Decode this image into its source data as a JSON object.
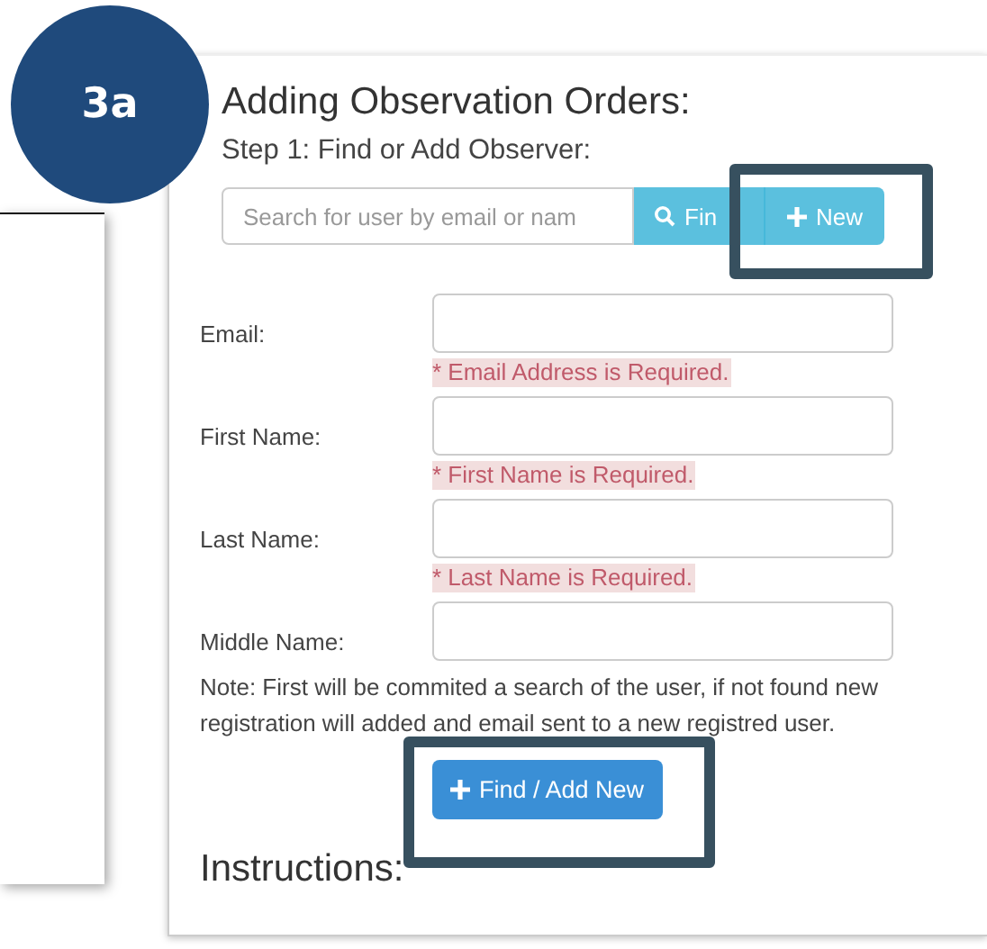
{
  "badge": {
    "label": "3a"
  },
  "title": "Adding Observation Orders:",
  "step": "Step 1: Find or Add Observer:",
  "search": {
    "placeholder": "Search for user by email or nam",
    "find_label": "Fin",
    "new_label": "New"
  },
  "fields": [
    {
      "label": "Email:",
      "error": "* Email Address is Required."
    },
    {
      "label": "First Name:",
      "error": "* First Name is Required."
    },
    {
      "label": "Last Name:",
      "error": "* Last Name is Required."
    },
    {
      "label": "Middle Name:"
    }
  ],
  "note": "Note: First will be commited a search of the user, if not found new registration will added and email sent to a new registred user.",
  "submit_label": "Find / Add New",
  "instructions_heading": "Instructions:"
}
